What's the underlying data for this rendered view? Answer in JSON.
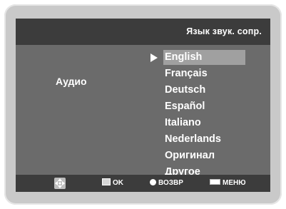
{
  "header": {
    "title": "Язык звук. сопр."
  },
  "section": {
    "label": "Аудио"
  },
  "languages": {
    "items": [
      {
        "label": "English",
        "selected": true
      },
      {
        "label": "Français",
        "selected": false
      },
      {
        "label": "Deutsch",
        "selected": false
      },
      {
        "label": "Español",
        "selected": false
      },
      {
        "label": "Italiano",
        "selected": false
      },
      {
        "label": "Nederlands",
        "selected": false
      },
      {
        "label": "Оригинал",
        "selected": false
      },
      {
        "label": "Другое",
        "selected": false
      }
    ]
  },
  "footer": {
    "move_icon": "move-arrows-icon",
    "ok_label": "OK",
    "ok_icon": "enter-icon",
    "return_label": "ВОЗВР",
    "return_icon": "return-icon",
    "menu_label": "МЕНЮ",
    "menu_icon": "menu-icon"
  },
  "colors": {
    "panel": "#6b6b6b",
    "bar": "#3c3c3c",
    "highlight": "#a0a0a0",
    "frame": "#c9c9c9"
  }
}
